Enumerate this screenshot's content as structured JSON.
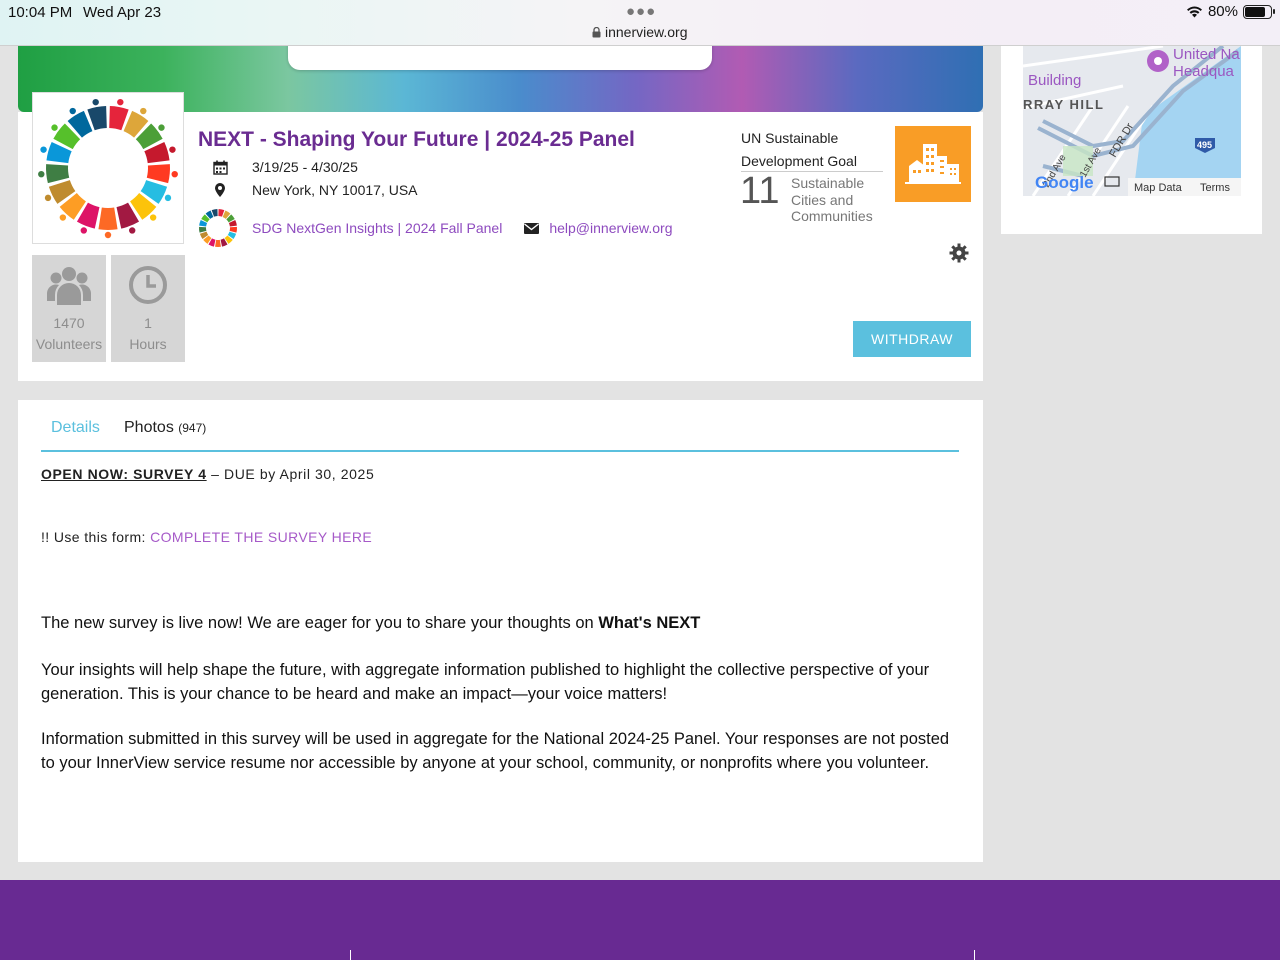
{
  "status_bar": {
    "time": "10:04 PM",
    "date": "Wed Apr 23",
    "url": "innerview.org",
    "battery_percent": "80%",
    "battery_level": 0.8
  },
  "event": {
    "title": "NEXT - Shaping Your Future | 2024-25 Panel",
    "dates": "3/19/25 - 4/30/25",
    "location": "New York, NY 10017, USA",
    "organization": "SDG NextGen Insights | 2024 Fall Panel",
    "email": "help@innerview.org"
  },
  "stats": {
    "volunteers_count": "1470",
    "volunteers_label": "Volunteers",
    "hours_count": "1",
    "hours_label": "Hours"
  },
  "sdg": {
    "heading_line1": "UN Sustainable",
    "heading_line2": "Development Goal",
    "number": "11",
    "name_line1": "Sustainable",
    "name_line2": "Cities and",
    "name_line3": "Communities",
    "badge_color": "#f99d26"
  },
  "actions": {
    "withdraw_label": "WITHDRAW"
  },
  "map": {
    "label_building": "Building",
    "label_un": "United Na",
    "label_hq": "Headqua",
    "label_murray_hill": "RRAY HILL",
    "label_fdr": "FDR Dr",
    "label_2ave": "2nd Ave",
    "label_1ave": "1st Ave",
    "label_495": "495",
    "google": "Google",
    "map_data": "Map Data",
    "terms": "Terms"
  },
  "tabs": {
    "details": "Details",
    "photos": "Photos",
    "photos_count": "(947)"
  },
  "details": {
    "open_now": "OPEN NOW: SURVEY 4",
    "due": " – DUE by April 30, 2025",
    "form_prefix": "!! Use this form: ",
    "survey_link": "COMPLETE THE SURVEY HERE",
    "p1_text": "The new survey is live now! We are eager for you to share your thoughts on ",
    "p1_bold": "What's NEXT",
    "p2": "Your insights will help shape the future, with aggregate information published to highlight the collective perspective of your generation. This is your chance to be heard and make an impact—your voice matters!",
    "p3": "Information submitted in this survey will be used in aggregate for the National 2024-25 Panel.  Your responses are not posted to your InnerView service resume nor accessible by anyone at your school, community, or nonprofits where you volunteer."
  },
  "colors": {
    "brand_purple": "#682a92",
    "title_purple": "#6a2c91",
    "link_purple": "#8e4bbf",
    "accent_cyan": "#5bc0de"
  }
}
